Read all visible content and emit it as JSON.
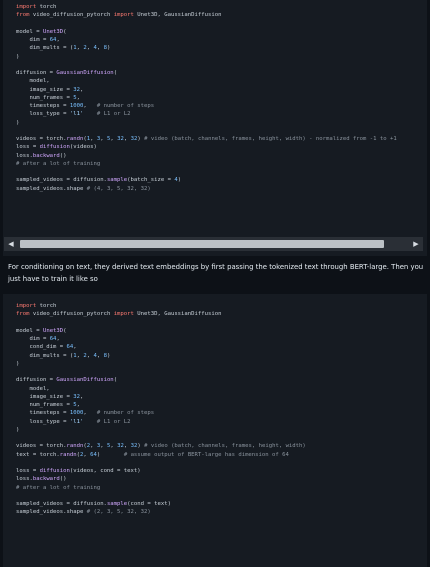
{
  "code1": {
    "lines": [
      [
        "import",
        " torch"
      ],
      [
        "from",
        " video_diffusion_pytorch ",
        "import",
        " Unet3D, GaussianDiffusion"
      ],
      [
        ""
      ],
      [
        "model = ",
        "Unet3D",
        "("
      ],
      [
        "    dim = ",
        "64",
        ","
      ],
      [
        "    dim_mults = (",
        "1",
        ", ",
        "2",
        ", ",
        "4",
        ", ",
        "8",
        ")"
      ],
      [
        ")"
      ],
      [
        ""
      ],
      [
        "diffusion = ",
        "GaussianDiffusion",
        "("
      ],
      [
        "    model,"
      ],
      [
        "    image_size = ",
        "32",
        ","
      ],
      [
        "    num_frames = ",
        "5",
        ","
      ],
      [
        "    timesteps = ",
        "1000",
        ",   ",
        "# number of steps"
      ],
      [
        "    loss_type = ",
        "'l1'",
        "    ",
        "# L1 or L2"
      ],
      [
        ")"
      ],
      [
        ""
      ],
      [
        "videos = torch.",
        "randn",
        "(",
        "1",
        ", ",
        "3",
        ", ",
        "5",
        ", ",
        "32",
        ", ",
        "32",
        ") ",
        "# video (batch, channels, frames, height, width) - normalized from -1 to +1"
      ],
      [
        "loss = ",
        "diffusion",
        "(videos)"
      ],
      [
        "loss.",
        "backward",
        "()"
      ],
      [
        "# after a lot of training"
      ],
      [
        ""
      ],
      [
        "sampled_videos = diffusion.",
        "sample",
        "(batch_size = ",
        "4",
        ")"
      ],
      [
        "sampled_videos.shape ",
        "# (4, 3, 5, 32, 32)"
      ]
    ]
  },
  "prose": {
    "text": "For conditioning on text, they derived text embeddings by first passing the tokenized text through BERT-large. Then you just have to train it like so"
  },
  "code2": {
    "lines": [
      [
        "import",
        " torch"
      ],
      [
        "from",
        " video_diffusion_pytorch ",
        "import",
        " Unet3D, GaussianDiffusion"
      ],
      [
        ""
      ],
      [
        "model = ",
        "Unet3D",
        "("
      ],
      [
        "    dim = ",
        "64",
        ","
      ],
      [
        "    cond_dim = ",
        "64",
        ","
      ],
      [
        "    dim_mults = (",
        "1",
        ", ",
        "2",
        ", ",
        "4",
        ", ",
        "8",
        ")"
      ],
      [
        ")"
      ],
      [
        ""
      ],
      [
        "diffusion = ",
        "GaussianDiffusion",
        "("
      ],
      [
        "    model,"
      ],
      [
        "    image_size = ",
        "32",
        ","
      ],
      [
        "    num_frames = ",
        "5",
        ","
      ],
      [
        "    timesteps = ",
        "1000",
        ",   ",
        "# number of steps"
      ],
      [
        "    loss_type = ",
        "'l1'",
        "    ",
        "# L1 or L2"
      ],
      [
        ")"
      ],
      [
        ""
      ],
      [
        "videos = torch.",
        "randn",
        "(",
        "2",
        ", ",
        "3",
        ", ",
        "5",
        ", ",
        "32",
        ", ",
        "32",
        ") ",
        "# video (batch, channels, frames, height, width)"
      ],
      [
        "text = torch.",
        "randn",
        "(",
        "2",
        ", ",
        "64",
        ")       ",
        "# assume output of BERT-large has dimension of 64"
      ],
      [
        ""
      ],
      [
        "loss = ",
        "diffusion",
        "(videos, cond = text)"
      ],
      [
        "loss.",
        "backward",
        "()"
      ],
      [
        "# after a lot of training"
      ],
      [
        ""
      ],
      [
        "sampled_videos = diffusion.",
        "sample",
        "(cond = text)"
      ],
      [
        "sampled_videos.shape ",
        "# (2, 3, 5, 32, 32)"
      ]
    ]
  },
  "scrollbar": {
    "left_icon": "triangle-left-icon",
    "right_icon": "triangle-right-icon",
    "left_glyph": "◀",
    "right_glyph": "▶"
  },
  "colors": {
    "background": "#0d1117",
    "code_background": "#161b22",
    "keyword": "#ff7b72",
    "function": "#d2a8ff",
    "number": "#79c0ff",
    "string": "#a5d6ff",
    "comment": "#8b949e",
    "text": "#c9d1d9"
  }
}
